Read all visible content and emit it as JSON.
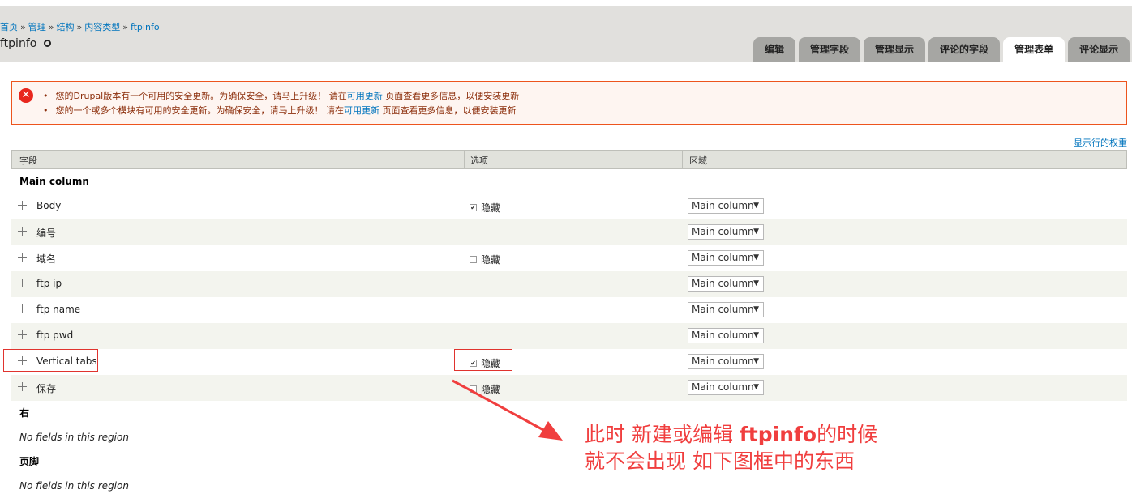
{
  "breadcrumb": {
    "items": [
      "首页",
      "管理",
      "结构",
      "内容类型"
    ],
    "current": "ftpinfo",
    "separator": "»"
  },
  "page": {
    "title": "ftpinfo",
    "settings_icon": "gear-icon"
  },
  "tabs": [
    {
      "label": "编辑",
      "active": false
    },
    {
      "label": "管理字段",
      "active": false
    },
    {
      "label": "管理显示",
      "active": false
    },
    {
      "label": "评论的字段",
      "active": false
    },
    {
      "label": "管理表单",
      "active": true
    },
    {
      "label": "评论显示",
      "active": false
    }
  ],
  "messages": {
    "icon": "error-icon",
    "items": [
      {
        "before": "您的Drupal版本有一个可用的安全更新。为确保安全，请马上升级！ 请在",
        "link": "可用更新",
        "after": " 页面查看更多信息，以便安装更新"
      },
      {
        "before": "您的一个或多个模块有可用的安全更新。为确保安全，请马上升级！ 请在",
        "link": "可用更新",
        "after": " 页面查看更多信息，以便安装更新"
      }
    ]
  },
  "row_weights_link": "显示行的权重",
  "table": {
    "headers": {
      "field": "字段",
      "options": "选项",
      "region": "区域"
    },
    "hide_label": "隐藏",
    "regions": [
      {
        "title": "Main column",
        "rows": [
          {
            "label": "Body",
            "hide": true,
            "region": "Main column"
          },
          {
            "label": "编号",
            "hide": null,
            "region": "Main column"
          },
          {
            "label": "域名",
            "hide": false,
            "region": "Main column"
          },
          {
            "label": "ftp ip",
            "hide": null,
            "region": "Main column"
          },
          {
            "label": "ftp name",
            "hide": null,
            "region": "Main column"
          },
          {
            "label": "ftp pwd",
            "hide": null,
            "region": "Main column"
          },
          {
            "label": "Vertical tabs",
            "hide": true,
            "region": "Main column"
          },
          {
            "label": "保存",
            "hide": false,
            "region": "Main column"
          }
        ]
      },
      {
        "title": "右",
        "empty": "No fields in this region"
      },
      {
        "title": "页脚",
        "empty": "No fields in this region"
      }
    ]
  },
  "annotation": {
    "line1_a": "此时 新建或编辑 ",
    "line1_b": "ftpinfo",
    "line1_c": "的时候",
    "line2": "就不会出现 如下图框中的东西",
    "color": "#f03e3e"
  }
}
